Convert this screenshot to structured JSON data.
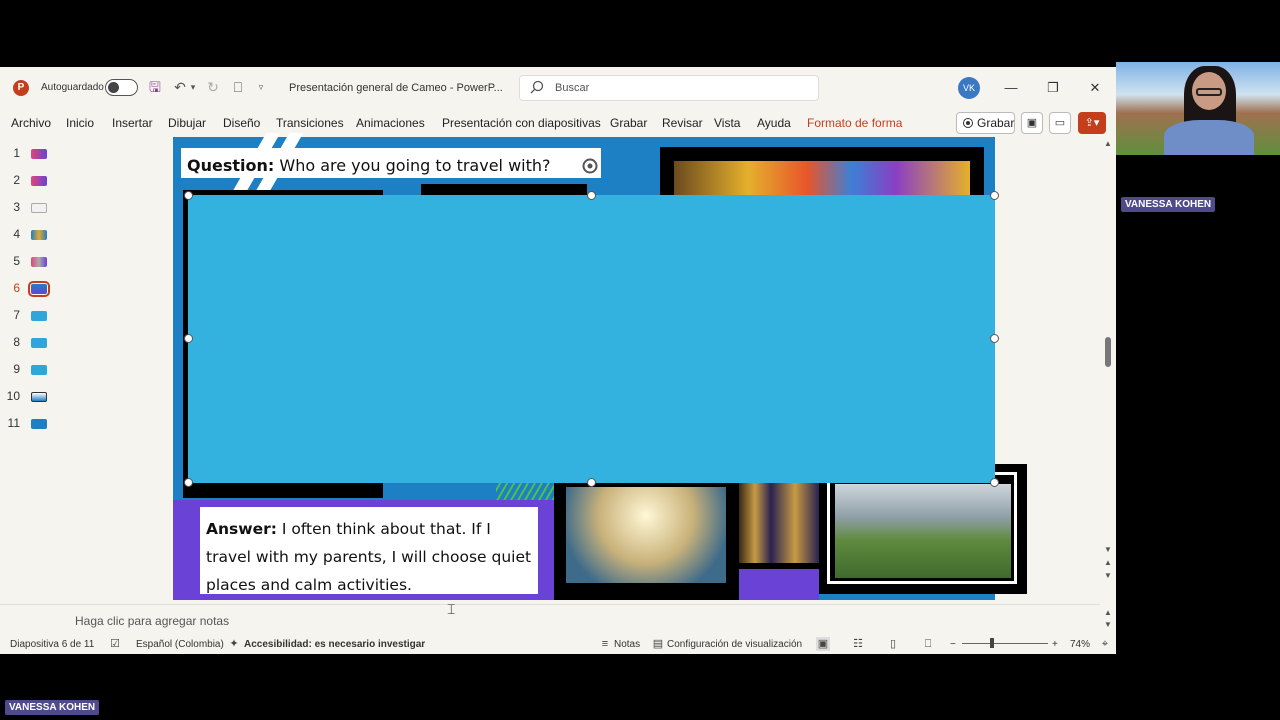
{
  "app": {
    "autosave_label": "Autoguardado",
    "doc_title": "Presentación general de Cameo  -  PowerP...",
    "search_placeholder": "Buscar",
    "user_initials": "VK"
  },
  "menu": {
    "items": [
      "Archivo",
      "Inicio",
      "Insertar",
      "Dibujar",
      "Diseño",
      "Transiciones",
      "Animaciones",
      "Presentación con diapositivas",
      "Grabar",
      "Revisar",
      "Vista",
      "Ayuda",
      "Formato de forma"
    ],
    "grabar_label": "Grabar"
  },
  "thumbnails": {
    "numbers": [
      "1",
      "2",
      "3",
      "4",
      "5",
      "6",
      "7",
      "8",
      "9",
      "10",
      "11"
    ],
    "active": "6"
  },
  "slide": {
    "question_label": "Question:",
    "question_text": " Who are you going to travel with?",
    "answer_label": "Answer:",
    "answer_text": " I often think about that. If I travel with my parents, I will choose quiet places and calm activities."
  },
  "notes_placeholder": "Haga clic para agregar notas",
  "status": {
    "slide_position": "Diapositiva 6 de 11",
    "language": "Español (Colombia)",
    "accessibility": "Accesibilidad: es necesario investigar",
    "notes": "Notas",
    "view_settings": "Configuración de visualización",
    "zoom": "74%"
  },
  "video": {
    "participant_name": "VANESSA KOHEN"
  },
  "colors": {
    "accent": "#c43e1c",
    "slide_bg": "#1d7fc4",
    "shape_fill": "#33b2e0",
    "purple": "#6a42d6"
  }
}
